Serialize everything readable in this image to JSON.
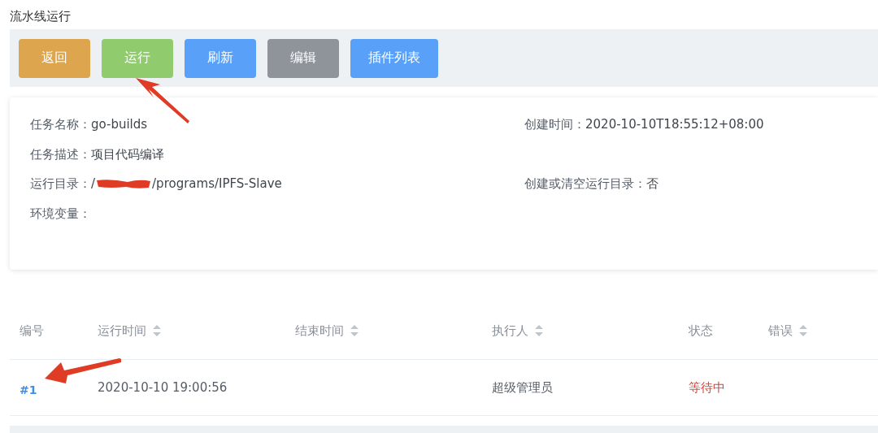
{
  "page_title": "流水线运行",
  "toolbar": [
    {
      "label": "返回",
      "kind": "warning"
    },
    {
      "label": "运行",
      "kind": "success"
    },
    {
      "label": "刷新",
      "kind": "primary"
    },
    {
      "label": "编辑",
      "kind": "info"
    },
    {
      "label": "插件列表",
      "kind": "primary"
    }
  ],
  "details": {
    "left": [
      {
        "label": "任务名称：",
        "value": "go-builds"
      },
      {
        "label": "任务描述：",
        "value": "项目代码编译"
      },
      {
        "label": "运行目录：",
        "value_prefix": "/",
        "value": "/programs/IPFS-Slave",
        "redacted": true
      },
      {
        "label": "环境变量："
      }
    ],
    "right": [
      {
        "label": "创建时间：",
        "value": "2020-10-10T18:55:12+08:00"
      },
      {
        "label": "创建或清空运行目录：",
        "value": "否"
      }
    ]
  },
  "table": {
    "columns": [
      {
        "label": "编号",
        "sortable": false
      },
      {
        "label": "运行时间",
        "sortable": true
      },
      {
        "label": "结束时间",
        "sortable": true
      },
      {
        "label": "执行人",
        "sortable": true
      },
      {
        "label": "状态",
        "sortable": false
      },
      {
        "label": "错误",
        "sortable": true
      }
    ],
    "rows": [
      {
        "id": "#1",
        "start": "2020-10-10 19:00:56",
        "end": "",
        "user": "超级管理员",
        "status": "等待中",
        "error": ""
      }
    ]
  }
}
